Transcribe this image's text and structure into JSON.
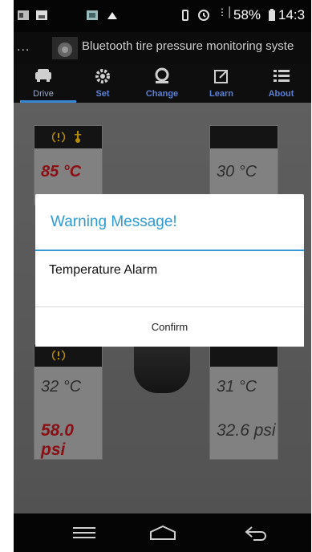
{
  "status_bar": {
    "signal": "⋮│",
    "battery_percent": "58%",
    "time": "14:3",
    "icons": [
      "screenshot-icon",
      "image-icon",
      "gallery-icon",
      "cloud-icon",
      "vibrate-icon",
      "alarm-icon",
      "signal-icon",
      "battery-icon"
    ]
  },
  "app": {
    "menu_dots": "...",
    "title": "Bluetooth tire pressure monitoring syste"
  },
  "tabs": [
    {
      "label": "Drive",
      "icon": "car-icon",
      "active": true
    },
    {
      "label": "Set",
      "icon": "gear-icon",
      "active": false
    },
    {
      "label": "Change",
      "icon": "tire-change-icon",
      "active": false
    },
    {
      "label": "Learn",
      "icon": "edit-icon",
      "active": false
    },
    {
      "label": "About",
      "icon": "list-icon",
      "active": false
    }
  ],
  "tires": {
    "front_left": {
      "temperature": "85 °C",
      "pressure": "",
      "alert_icons": [
        "tire-alert-icon",
        "temperature-icon"
      ]
    },
    "front_right": {
      "temperature": "30 °C",
      "pressure": ""
    },
    "rear_left": {
      "temperature": "32 °C",
      "pressure": "58.0 psi",
      "alert_icons": [
        "tire-alert-icon"
      ]
    },
    "rear_right": {
      "temperature": "31 °C",
      "pressure": "32.6 psi"
    }
  },
  "dialog": {
    "title": "Warning Message!",
    "message": "Temperature Alarm",
    "confirm_label": "Confirm"
  },
  "navigation": [
    "menu-icon",
    "home-icon",
    "back-icon"
  ],
  "colors": {
    "alert_red": "#b3141b",
    "normal_text": "#3c3c3c",
    "accent_blue": "#2e9ad1",
    "alert_icon_yellow": "#e8b400"
  }
}
